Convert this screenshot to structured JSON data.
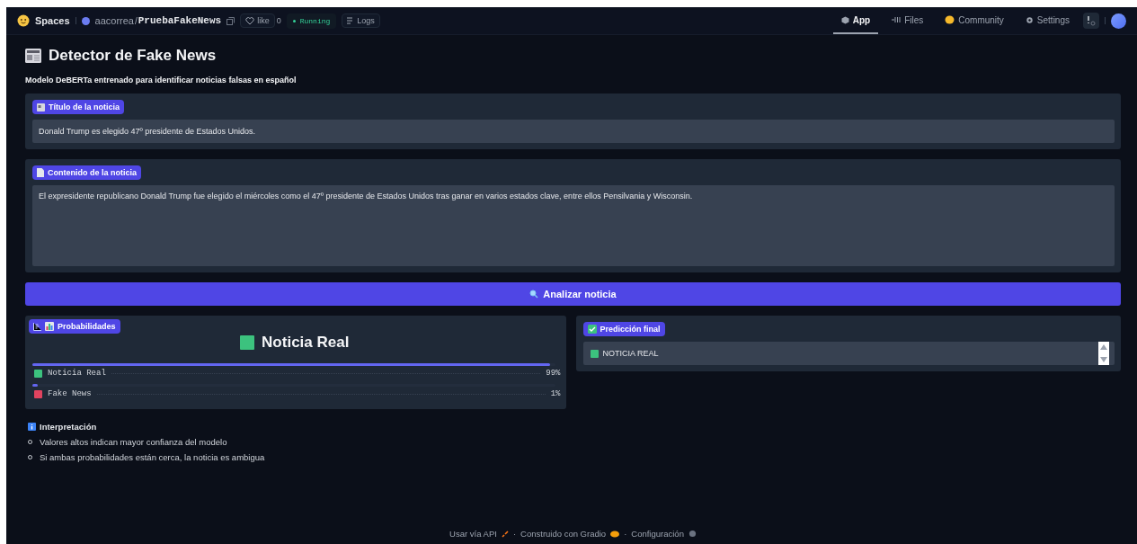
{
  "header": {
    "brand": "Spaces",
    "owner": "aacorrea",
    "slash": "/",
    "repo": "PruebaFakeNews",
    "like_label": "like",
    "like_count": "0",
    "status": "Running",
    "logs": "Logs",
    "tabs": [
      {
        "label": "App",
        "selected": true
      },
      {
        "label": "Files",
        "selected": false
      },
      {
        "label": "Community",
        "selected": false
      },
      {
        "label": "Settings",
        "selected": false
      }
    ]
  },
  "title": "Detector de Fake News",
  "subtitle": "Modelo DeBERTa entrenado para identificar noticias falsas en español",
  "fields": [
    {
      "label": "Título de la noticia",
      "value": "Donald Trump es elegido 47º presidente de Estados Unidos.",
      "multiline": false
    },
    {
      "label": "Contenido de la noticia",
      "value": "El expresidente republicano Donald Trump fue elegido el miércoles como el 47º presidente de Estados Unidos tras ganar en varios estados clave, entre ellos Pensilvania y Wisconsin.",
      "multiline": true
    }
  ],
  "button": "Analizar noticia",
  "probabilities": {
    "label": "Probabilidades",
    "heading": "Noticia Real",
    "rows": [
      {
        "name": "Noticia Real",
        "level": 0.99,
        "reading": "99%",
        "color": "#3cc27e"
      },
      {
        "name": "Fake News",
        "level": 0.01,
        "reading": "1%",
        "color": "#e0435f"
      }
    ]
  },
  "prediction": {
    "label": "Predicción final",
    "value": "NOTICIA REAL",
    "color": "#3cc27e"
  },
  "interpretation": {
    "heading": "Interpretación",
    "items": [
      "Valores altos indican mayor confianza del modelo",
      "Si ambas probabilidades están cerca, la noticia es ambigua"
    ]
  },
  "footer": {
    "separator": "·",
    "links": [
      "Usar vía API",
      "Construido con Gradio",
      "Configuración"
    ]
  }
}
